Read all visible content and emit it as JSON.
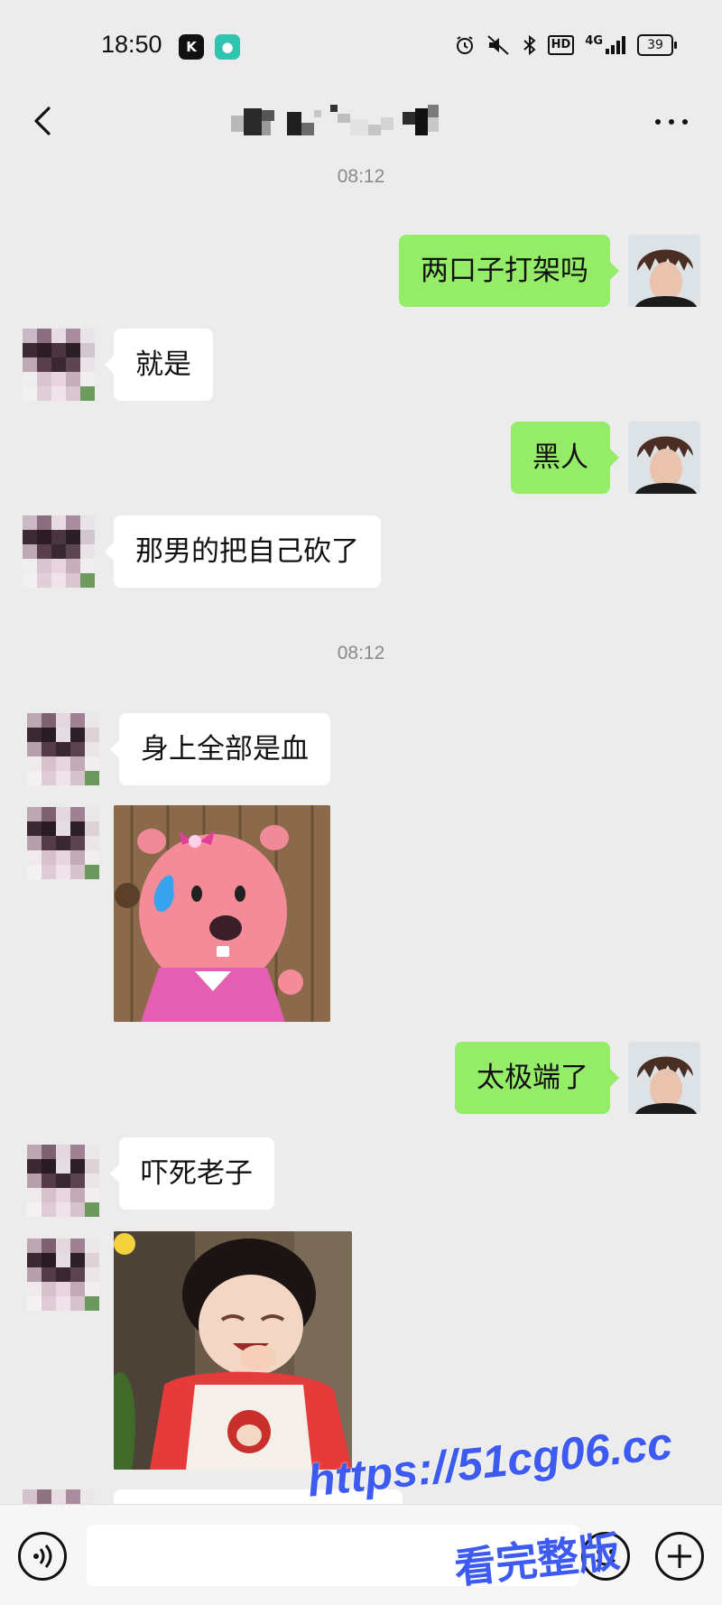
{
  "status_bar": {
    "time": "18:50",
    "hd_label": "HD",
    "network_label": "4G",
    "battery_level": "39"
  },
  "header": {
    "title_obscured": true
  },
  "timestamps": [
    "08:12",
    "08:12"
  ],
  "messages": [
    {
      "direction": "out",
      "text": "两口子打架吗"
    },
    {
      "direction": "in",
      "text": "就是"
    },
    {
      "direction": "out",
      "text": "黑人"
    },
    {
      "direction": "in",
      "text": "那男的把自己砍了"
    },
    {
      "direction": "in",
      "text": "身上全部是血"
    },
    {
      "direction": "in",
      "type": "sticker",
      "sticker": "pink-beaver-sweat"
    },
    {
      "direction": "out",
      "text": "太极端了"
    },
    {
      "direction": "in",
      "text": "吓死老子"
    },
    {
      "direction": "in",
      "type": "sticker",
      "sticker": "laughing-child"
    }
  ],
  "input_bar": {
    "placeholder": ""
  },
  "watermark": {
    "url": "https://51cg06.cc",
    "caption": "看完整版"
  },
  "colors": {
    "background": "#ececec",
    "outgoing_bubble": "#95ec69",
    "incoming_bubble": "#ffffff",
    "watermark": "#3d5bf0"
  }
}
